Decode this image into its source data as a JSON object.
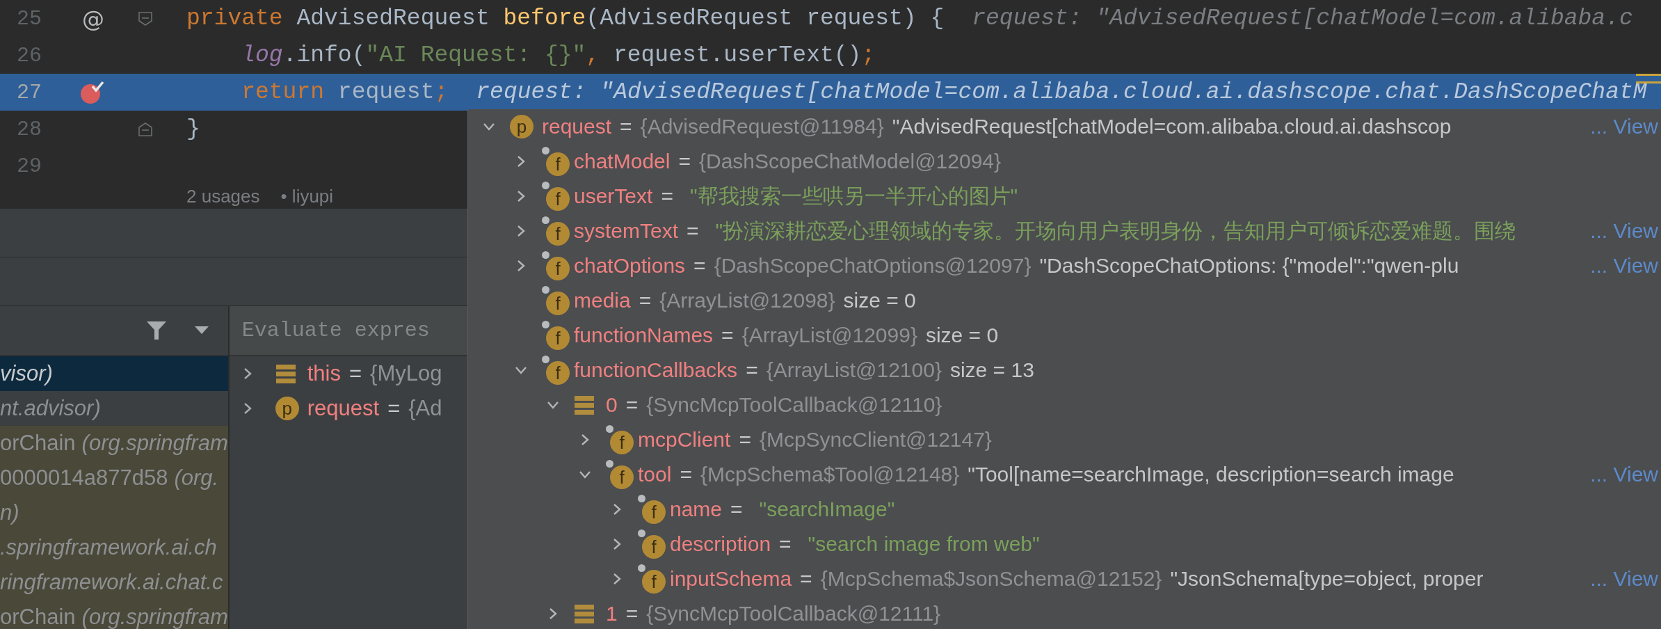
{
  "editor": {
    "lines": [
      {
        "number": "25",
        "gutter_mark": "@",
        "fold_start": true,
        "current": false,
        "tokens": [
          {
            "t": "private ",
            "kind": "keyword"
          },
          {
            "t": "AdvisedRequest ",
            "kind": "plain"
          },
          {
            "t": "before",
            "kind": "decl"
          },
          {
            "t": "(AdvisedRequest request) {",
            "kind": "plain"
          }
        ],
        "hint": "request: \"AdvisedRequest[chatModel=com.alibaba.c"
      },
      {
        "number": "26",
        "current": false,
        "tokens": [
          {
            "t": "    log",
            "kind": "field"
          },
          {
            "t": ".info(",
            "kind": "plain"
          },
          {
            "t": "\"AI Request: {}\"",
            "kind": "string"
          },
          {
            "t": ", ",
            "kind": "punct"
          },
          {
            "t": "request.userText()",
            "kind": "plain"
          },
          {
            "t": ";",
            "kind": "punct"
          }
        ]
      },
      {
        "number": "27",
        "breakpoint": true,
        "current": true,
        "tokens": [
          {
            "t": "    return ",
            "kind": "keyword"
          },
          {
            "t": "request",
            "kind": "plain"
          },
          {
            "t": ";",
            "kind": "punct"
          }
        ],
        "hint": "request: \"AdvisedRequest[chatModel=com.alibaba.cloud.ai.dashscope.chat.DashScopeChatM"
      },
      {
        "number": "28",
        "fold_end": true,
        "current": false,
        "tokens": [
          {
            "t": "}",
            "kind": "plain"
          }
        ]
      },
      {
        "number": "29",
        "current": false
      }
    ],
    "usages": "2 usages",
    "author": "• liyupi"
  },
  "frames": {
    "items": [
      {
        "location": "visor)",
        "selected": true,
        "library": false
      },
      {
        "location": "nt.advisor)",
        "selected": false,
        "library": false
      },
      {
        "method": "orChain",
        "location": "(org.springfram",
        "selected": false,
        "library": true
      },
      {
        "method": "0000014a877d58",
        "location": "(org.",
        "selected": false,
        "library": true
      },
      {
        "location": "n)",
        "selected": false,
        "library": true
      },
      {
        "location": ".springframework.ai.ch",
        "selected": false,
        "library": true
      },
      {
        "location": "ringframework.ai.chat.c",
        "selected": false,
        "library": true
      },
      {
        "method": "orChain",
        "location": "(org.springfram",
        "selected": false,
        "library": true
      }
    ]
  },
  "variables": {
    "placeholder": "Evaluate expres",
    "items": [
      {
        "kind": "object",
        "name": "this",
        "operator": "=",
        "value": "{MyLog",
        "expanded": false
      },
      {
        "kind": "param",
        "badge": "p",
        "name": "request",
        "operator": "=",
        "value": "{Ad",
        "expanded": false
      }
    ]
  },
  "popup": {
    "tree": [
      {
        "kind": "param",
        "badge": "p",
        "name": "request",
        "operator": "=",
        "type": "{AdvisedRequest@11984}",
        "value": {
          "text": "\"AdvisedRequest[chatModel=com.alibaba.cloud.ai.dashscop",
          "kind": "plain"
        },
        "link": "... View",
        "expanded": true,
        "children": [
          {
            "kind": "field",
            "badge": "f",
            "name": "chatModel",
            "operator": "=",
            "type": "{DashScopeChatModel@12094}",
            "expanded": false
          },
          {
            "kind": "field",
            "badge": "f",
            "name": "userText",
            "operator": "=",
            "value": {
              "text": "\"帮我搜索一些哄另一半开心的图片\"",
              "kind": "string"
            },
            "expanded": false
          },
          {
            "kind": "field",
            "badge": "f",
            "name": "systemText",
            "operator": "=",
            "value": {
              "text": "\"扮演深耕恋爱心理领域的专家。开场向用户表明身份，告知用户可倾诉恋爱难题。围绕",
              "kind": "string"
            },
            "link": "... View",
            "expanded": false
          },
          {
            "kind": "field",
            "badge": "f",
            "name": "chatOptions",
            "operator": "=",
            "type": "{DashScopeChatOptions@12097}",
            "value": {
              "text": "\"DashScopeChatOptions: {\"model\":\"qwen-plu",
              "kind": "plain"
            },
            "link": "... View",
            "expanded": false
          },
          {
            "kind": "field",
            "badge": "f",
            "name": "media",
            "operator": "=",
            "type": "{ArrayList@12098}",
            "value": {
              "text": "size = 0",
              "kind": "plain"
            },
            "expandable": false
          },
          {
            "kind": "field",
            "badge": "f",
            "name": "functionNames",
            "operator": "=",
            "type": "{ArrayList@12099}",
            "value": {
              "text": "size = 0",
              "kind": "plain"
            },
            "expandable": false
          },
          {
            "kind": "field",
            "badge": "f",
            "name": "functionCallbacks",
            "operator": "=",
            "type": "{ArrayList@12100}",
            "value": {
              "text": "size = 13",
              "kind": "plain"
            },
            "expanded": true,
            "children": [
              {
                "kind": "element",
                "name": "0",
                "operator": "=",
                "type": "{SyncMcpToolCallback@12110}",
                "expanded": true,
                "children": [
                  {
                    "kind": "field",
                    "badge": "f",
                    "name": "mcpClient",
                    "operator": "=",
                    "type": "{McpSyncClient@12147}",
                    "expanded": false
                  },
                  {
                    "kind": "field",
                    "badge": "f",
                    "name": "tool",
                    "operator": "=",
                    "type": "{McpSchema$Tool@12148}",
                    "value": {
                      "text": "\"Tool[name=searchImage, description=search image",
                      "kind": "plain"
                    },
                    "link": "... View",
                    "expanded": true,
                    "children": [
                      {
                        "kind": "field",
                        "badge": "f",
                        "name": "name",
                        "operator": "=",
                        "value": {
                          "text": "\"searchImage\"",
                          "kind": "string"
                        },
                        "expanded": false
                      },
                      {
                        "kind": "field",
                        "badge": "f",
                        "name": "description",
                        "operator": "=",
                        "value": {
                          "text": "\"search image from web\"",
                          "kind": "string"
                        },
                        "expanded": false
                      },
                      {
                        "kind": "field",
                        "badge": "f",
                        "name": "inputSchema",
                        "operator": "=",
                        "type": "{McpSchema$JsonSchema@12152}",
                        "value": {
                          "text": "\"JsonSchema[type=object, proper",
                          "kind": "plain"
                        },
                        "link": "... View",
                        "expanded": false
                      }
                    ]
                  }
                ]
              },
              {
                "kind": "element",
                "name": "1",
                "operator": "=",
                "type": "{SyncMcpToolCallback@12111}",
                "expanded": false
              }
            ]
          }
        ]
      }
    ]
  }
}
